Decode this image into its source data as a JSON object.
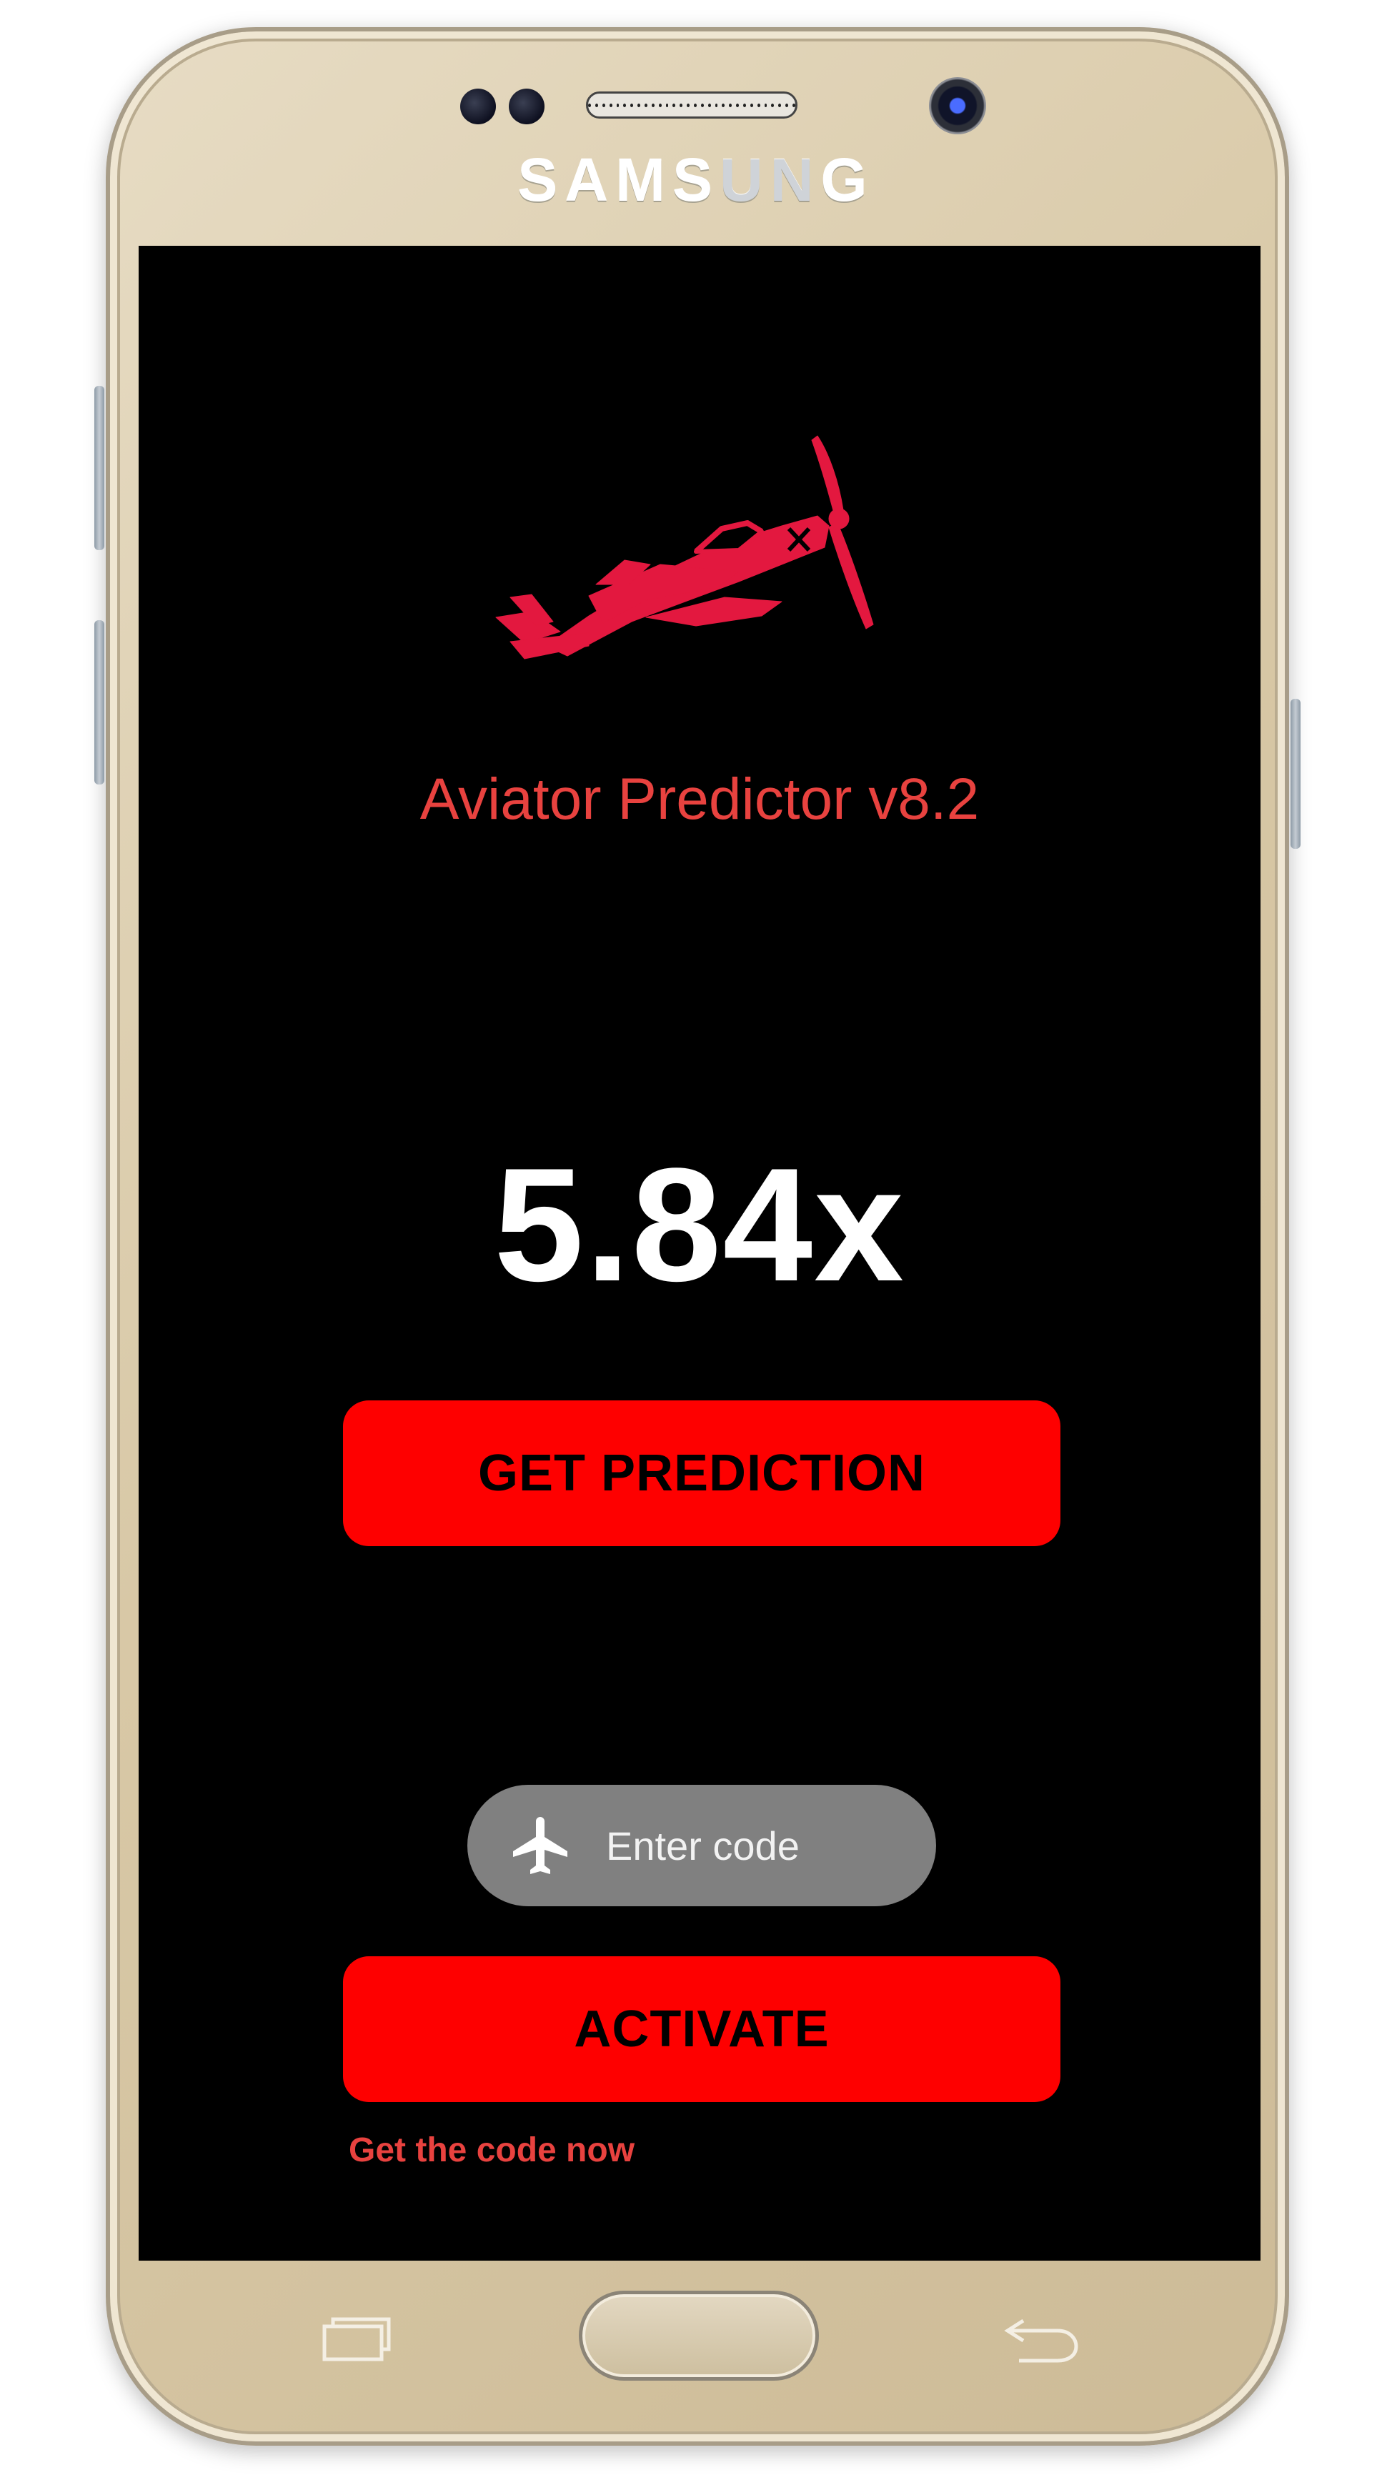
{
  "device": {
    "brand": "SAMSUNG"
  },
  "app": {
    "title": "Aviator Predictor v8.2",
    "logo_icon": "red-propeller-plane-icon",
    "multiplier": "5.84x",
    "predict_button_label": "GET PREDICTION",
    "code_field": {
      "placeholder": "Enter code",
      "value": "",
      "icon": "airplane-icon"
    },
    "activate_button_label": "ACTIVATE",
    "get_code_link": "Get the code now"
  },
  "colors": {
    "accent": "#fe0000",
    "title_text": "#e8423f",
    "screen_background": "#000000",
    "input_background": "#808080",
    "phone_body": "#d8c8a6"
  },
  "hardware_keys": [
    "recent-apps-key",
    "home-button",
    "back-key"
  ]
}
